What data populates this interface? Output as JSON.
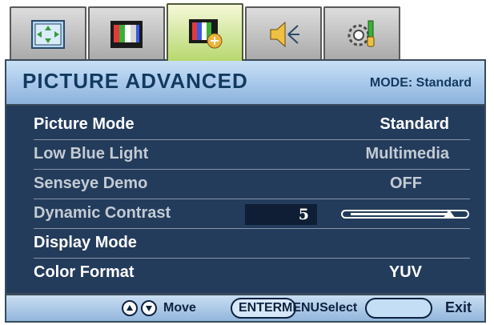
{
  "tabs": [
    {
      "icon": "display-adjust-icon",
      "active": false
    },
    {
      "icon": "picture-icon",
      "active": false
    },
    {
      "icon": "picture-advanced-icon",
      "active": true
    },
    {
      "icon": "audio-icon",
      "active": false
    },
    {
      "icon": "system-settings-icon",
      "active": false
    }
  ],
  "header": {
    "title": "PICTURE ADVANCED",
    "mode": "MODE: Standard"
  },
  "menu": {
    "picture_mode": {
      "label": "Picture Mode",
      "value": "Standard"
    },
    "low_blue_light": {
      "label": "Low Blue Light",
      "value": "Multimedia"
    },
    "senseye_demo": {
      "label": "Senseye Demo",
      "value": "OFF"
    },
    "dynamic_contrast": {
      "label": "Dynamic Contrast",
      "value": "5",
      "slider_level_percent": 88
    },
    "display_mode": {
      "label": "Display Mode",
      "value": ""
    },
    "color_format": {
      "label": "Color Format",
      "value": "YUV"
    }
  },
  "footer": {
    "move": "Move",
    "enter": "ENTER",
    "select_overlap": "MENUSelect",
    "exit": "Exit"
  },
  "colors": {
    "panel": "#243c5c",
    "header": "#a9c9eb",
    "active_tab": "#cfe59a",
    "text_dark": "#123a5e"
  }
}
